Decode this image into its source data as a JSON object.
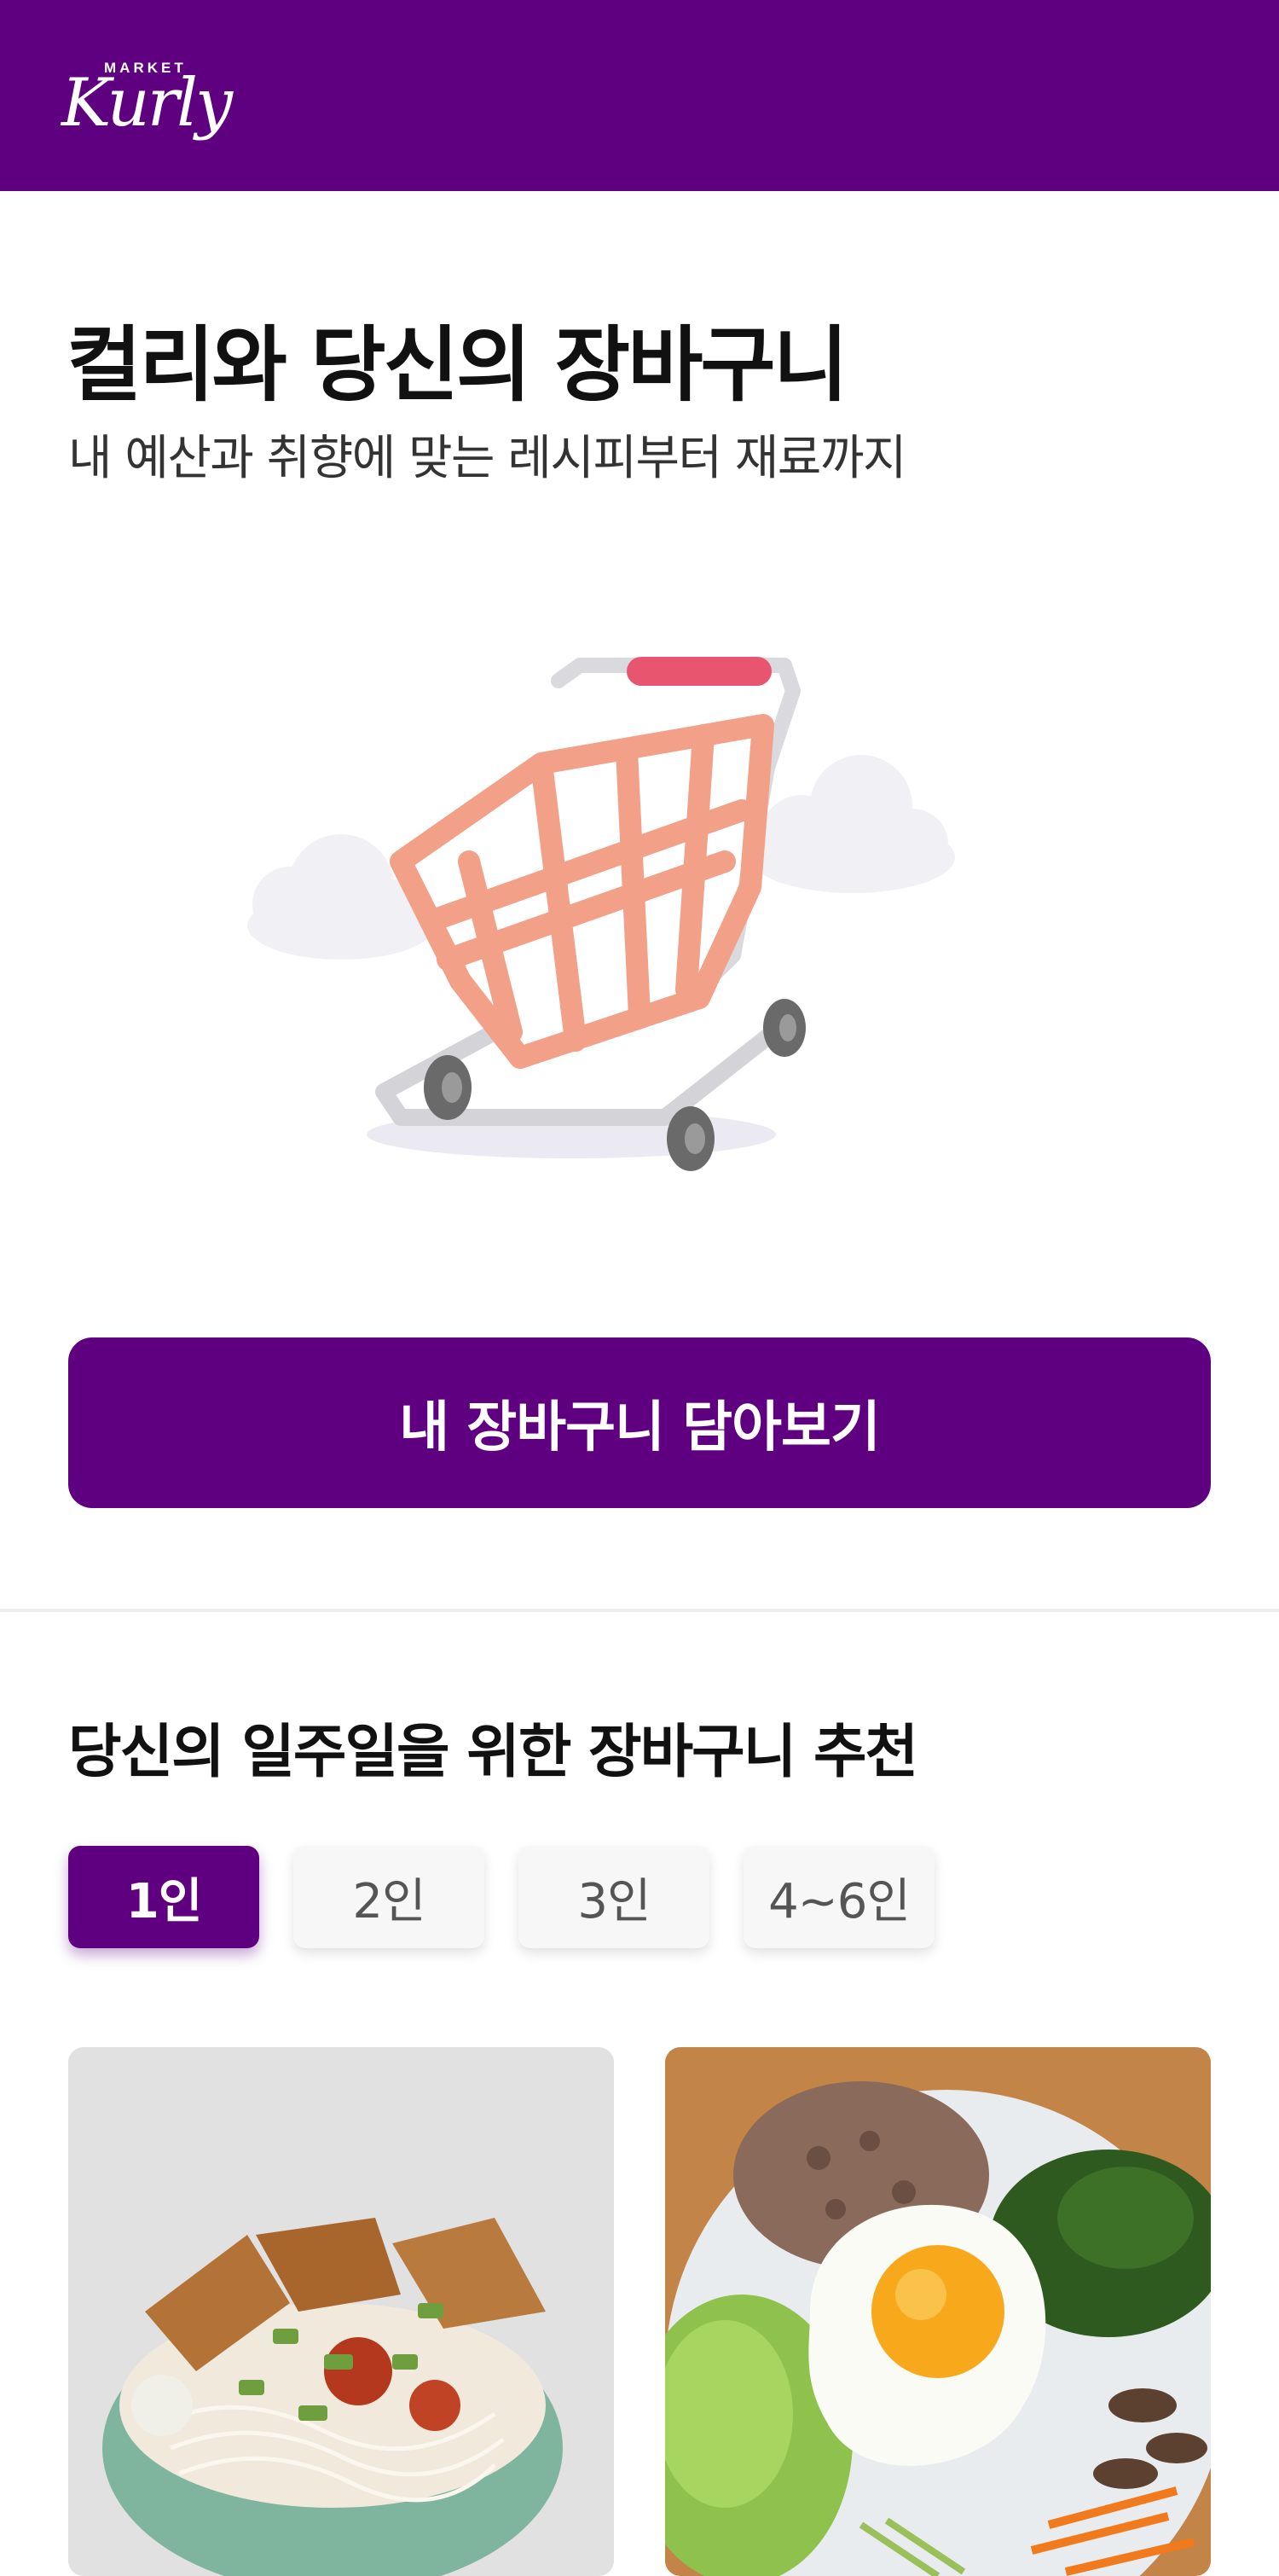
{
  "header": {
    "logo_market": "MARKET",
    "logo_kurly": "Kurly",
    "background": "#5f0080"
  },
  "hero": {
    "title": "컬리와 당신의 장바구니",
    "subtitle": "내 예산과 취향에 맞는 레시피부터 재료까지",
    "illustration": "shopping-cart-with-clouds",
    "cta_label": "내 장바구니 담아보기"
  },
  "recommend": {
    "title": "당신의 일주일을 위한 장바구니 추천",
    "tabs": [
      {
        "label": "1인",
        "selected": true
      },
      {
        "label": "2인",
        "selected": false
      },
      {
        "label": "3인",
        "selected": false
      },
      {
        "label": "4~6인",
        "selected": false
      }
    ],
    "cards": [
      {
        "image": "noodle-bowl-with-tofu-photo"
      },
      {
        "image": "bibimbap-with-fried-egg-photo"
      }
    ]
  },
  "colors": {
    "brand_purple": "#5f0080",
    "chip_bg": "#f7f7f7",
    "cart_orange": "#f2a088",
    "cart_handle": "#e8556f"
  }
}
